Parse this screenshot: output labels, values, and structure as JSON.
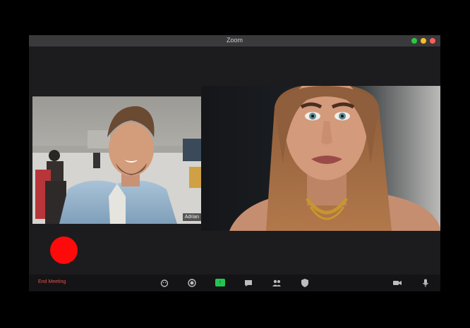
{
  "window": {
    "title": "Zoom"
  },
  "participants": [
    {
      "name": "Adrian"
    },
    {
      "name": ""
    }
  ],
  "toolbar": {
    "end_meeting_label": "End Meeting",
    "icons": [
      "reactions-icon",
      "record-icon",
      "share-screen-icon",
      "chat-icon",
      "participants-icon",
      "security-icon",
      "video-icon",
      "microphone-icon"
    ]
  },
  "colors": {
    "record_indicator": "#ff0a0a",
    "share_green": "#23c552",
    "end_meeting": "#e2544e"
  }
}
